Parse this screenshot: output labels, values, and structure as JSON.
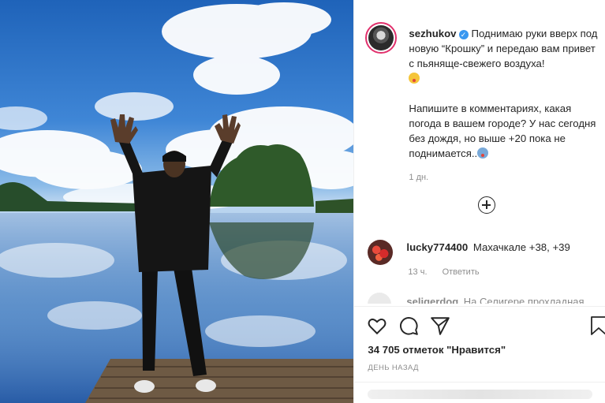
{
  "post": {
    "username": "sezhukov",
    "caption_line1": "Поднимаю руки вверх под новую “Крошку” и передаю вам привет с пьяняще-свежего воздуха!",
    "caption_line2": "Напишите в комментариях, какая погода в вашем городе? У нас сегодня без дождя, но выше +20 пока не поднимается..",
    "caption_time": "1 дн.",
    "likes": "34 705 отметок \"Нравится\"",
    "posted_ago": "ДЕНЬ НАЗАД"
  },
  "comments": [
    {
      "username": "lucky774400",
      "text": "Махачкале +38, +39",
      "time": "13 ч.",
      "reply": "Ответить"
    },
    {
      "username": "seligerdog",
      "text": "На Селигере прохладная"
    }
  ],
  "icons": {
    "like": "heart-icon",
    "comment": "comment-icon",
    "share": "paper-plane-icon",
    "save": "bookmark-icon",
    "load_more": "plus-circle-icon",
    "verified": "verified-badge-icon"
  },
  "colors": {
    "accent": "#3897f0",
    "story_ring": "#e1306c",
    "text": "#262626",
    "muted": "#8e8e8e"
  }
}
